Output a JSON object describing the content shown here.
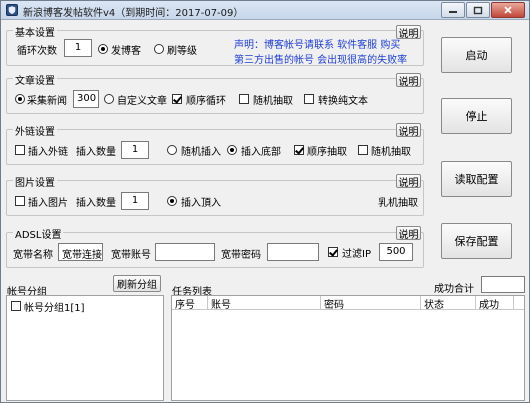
{
  "window": {
    "title": "新浪博客发帖软件v4（到期时间：2017-07-09）"
  },
  "basic": {
    "title": "基本设置",
    "loop_label": "循环次数",
    "loop_value": "1",
    "radio_blog": "发博客",
    "radio_upgrade": "刷等级",
    "help": "说明",
    "notice_line1": "声明：博客帐号请联系 软件客服 购买",
    "notice_line2": "第三方出售的帐号 会出现很高的失败率"
  },
  "article": {
    "title": "文章设置",
    "radio_collect": "采集新闻",
    "collect_value": "300",
    "radio_custom": "自定义文章",
    "check_order": "顺序循环",
    "check_random": "随机抽取",
    "check_plain": "转换纯文本",
    "help": "说明"
  },
  "links": {
    "title": "外链设置",
    "check_insert": "插入外链",
    "count_label": "插入数量",
    "count_value": "1",
    "radio_random": "随机插入",
    "radio_bottom": "插入底部",
    "check_order": "顺序抽取",
    "check_random": "随机抽取",
    "help": "说明"
  },
  "images": {
    "title": "图片设置",
    "check_insert": "插入图片",
    "count_label": "插入数量",
    "count_value": "1",
    "radio_top": "插入頂入",
    "extra": "乳机抽取",
    "help": "说明"
  },
  "adsl": {
    "title": "ADSL设置",
    "name_label": "宽带名称",
    "name_value": "宽带连接",
    "account_label": "宽带账号",
    "account_value": "",
    "password_label": "宽带密码",
    "password_value": "",
    "check_filter": "过滤IP",
    "filter_value": "500",
    "help": "说明"
  },
  "actions": {
    "start": "启动",
    "stop": "停止",
    "read_config": "读取配置",
    "save_config": "保存配置"
  },
  "success_total_label": "成功合计",
  "success_total_value": "",
  "accounts": {
    "title": "帐号分组",
    "refresh": "刷新分组",
    "group_item": "帐号分组1[1]"
  },
  "tasks": {
    "title": "任务列表",
    "columns": [
      "序号",
      "账号",
      "密码",
      "状态",
      "成功"
    ]
  }
}
